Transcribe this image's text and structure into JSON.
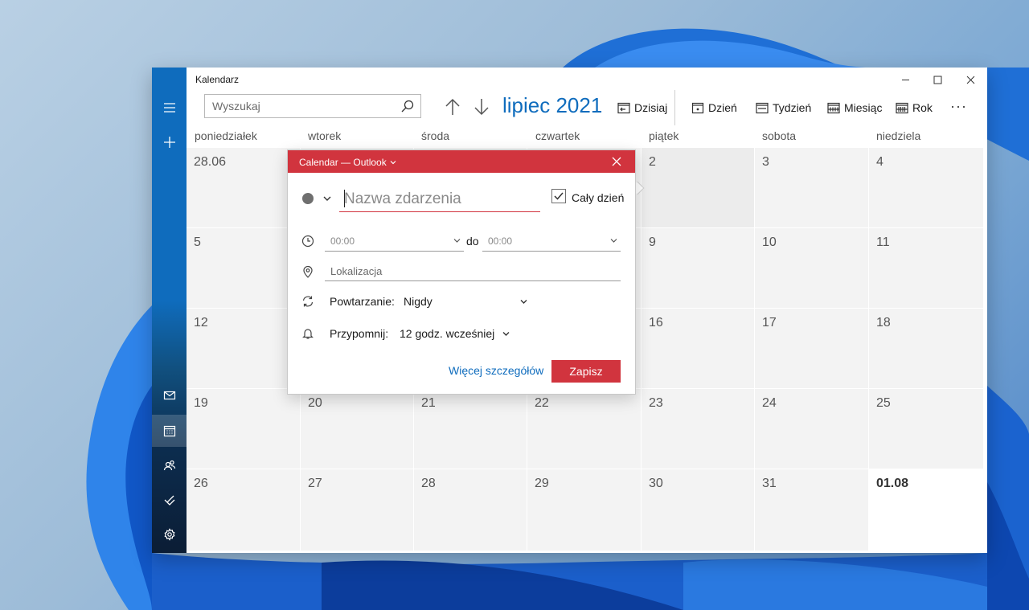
{
  "app": {
    "title": "Kalendarz"
  },
  "search": {
    "placeholder": "Wyszukaj"
  },
  "header": {
    "month_title": "lipiec 2021"
  },
  "toolbar": {
    "today": "Dzisiaj",
    "day": "Dzień",
    "week": "Tydzień",
    "month": "Miesiąc",
    "year": "Rok",
    "more": "···"
  },
  "weekdays": [
    "poniedziałek",
    "wtorek",
    "środa",
    "czwartek",
    "piątek",
    "sobota",
    "niedziela"
  ],
  "weeks": [
    [
      "28.06",
      "",
      "",
      "",
      "2",
      "3",
      "4"
    ],
    [
      "5",
      "",
      "",
      "",
      "9",
      "10",
      "11"
    ],
    [
      "12",
      "",
      "",
      "",
      "16",
      "17",
      "18"
    ],
    [
      "19",
      "20",
      "21",
      "22",
      "23",
      "24",
      "25"
    ],
    [
      "26",
      "27",
      "28",
      "29",
      "30",
      "31",
      "01.08"
    ]
  ],
  "popup": {
    "calendar_name": "Calendar — Outlook",
    "event_name_placeholder": "Nazwa zdarzenia",
    "all_day_label": "Cały dzień",
    "all_day_checked": true,
    "start_time": "00:00",
    "to_label": "do",
    "end_time": "00:00",
    "location_placeholder": "Lokalizacja",
    "repeat_label": "Powtarzanie:",
    "repeat_value": "Nigdy",
    "remind_label": "Przypomnij:",
    "remind_value": "12 godz. wcześniej",
    "more_details": "Więcej szczegółów",
    "save": "Zapisz"
  },
  "colors": {
    "accent": "#0f6cbd",
    "popup_header": "#d1343e",
    "event_color": "#6f6f6f"
  },
  "icons": {
    "sidebar": [
      "hamburger-icon",
      "plus-icon",
      "mail-icon",
      "calendar-icon",
      "people-icon",
      "todo-icon",
      "gear-icon"
    ],
    "toolbar": [
      "arrow-up-icon",
      "arrow-down-icon",
      "today-icon",
      "day-view-icon",
      "week-view-icon",
      "month-view-icon",
      "year-view-icon"
    ],
    "popup": [
      "clock-icon",
      "location-icon",
      "repeat-icon",
      "bell-icon"
    ]
  }
}
